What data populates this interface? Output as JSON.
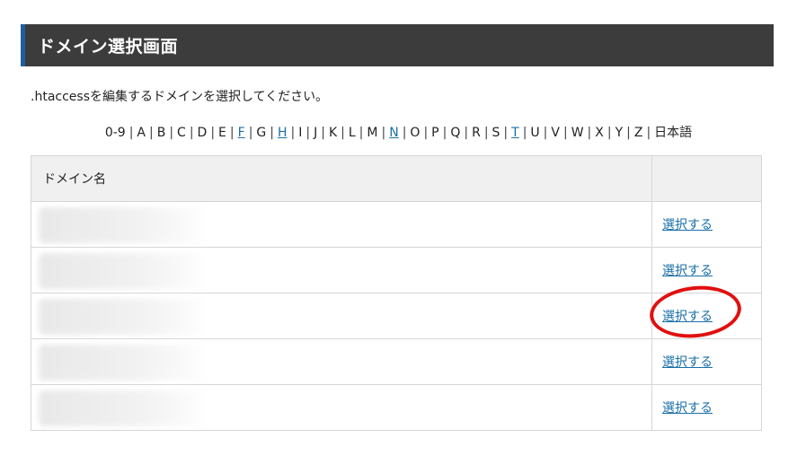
{
  "header": {
    "title": "ドメイン選択画面"
  },
  "instruction": ".htaccessを編集するドメインを選択してください。",
  "alpha_index": {
    "items": [
      {
        "label": "0-9",
        "active": false
      },
      {
        "label": "A",
        "active": false
      },
      {
        "label": "B",
        "active": false
      },
      {
        "label": "C",
        "active": false
      },
      {
        "label": "D",
        "active": false
      },
      {
        "label": "E",
        "active": false
      },
      {
        "label": "F",
        "active": true
      },
      {
        "label": "G",
        "active": false
      },
      {
        "label": "H",
        "active": true
      },
      {
        "label": "I",
        "active": false
      },
      {
        "label": "J",
        "active": false
      },
      {
        "label": "K",
        "active": false
      },
      {
        "label": "L",
        "active": false
      },
      {
        "label": "M",
        "active": false
      },
      {
        "label": "N",
        "active": true
      },
      {
        "label": "O",
        "active": false
      },
      {
        "label": "P",
        "active": false
      },
      {
        "label": "Q",
        "active": false
      },
      {
        "label": "R",
        "active": false
      },
      {
        "label": "S",
        "active": false
      },
      {
        "label": "T",
        "active": true
      },
      {
        "label": "U",
        "active": false
      },
      {
        "label": "V",
        "active": false
      },
      {
        "label": "W",
        "active": false
      },
      {
        "label": "X",
        "active": false
      },
      {
        "label": "Y",
        "active": false
      },
      {
        "label": "Z",
        "active": false
      },
      {
        "label": "日本語",
        "active": false
      }
    ]
  },
  "table": {
    "header_domain": "ドメイン名",
    "header_action": "",
    "rows": [
      {
        "action_label": "選択する"
      },
      {
        "action_label": "選択する"
      },
      {
        "action_label": "選択する"
      },
      {
        "action_label": "選択する"
      },
      {
        "action_label": "選択する"
      }
    ]
  },
  "colors": {
    "header_bg": "#3c3c3c",
    "header_accent": "#1f5fa0",
    "link": "#1a6fa8",
    "highlight": "#e01010"
  }
}
